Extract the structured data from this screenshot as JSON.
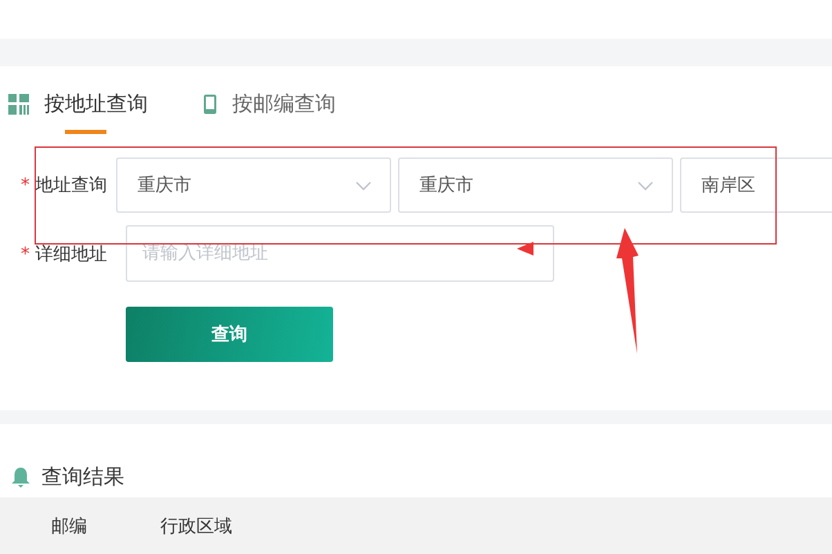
{
  "tabs": [
    {
      "label": "按地址查询",
      "selected": true
    },
    {
      "label": "按邮编查询",
      "selected": false
    }
  ],
  "form": {
    "address_label": "地址查询",
    "required_mark": "*",
    "selects": [
      {
        "value": "重庆市",
        "cut": false
      },
      {
        "value": "重庆市",
        "cut": false
      },
      {
        "value": "南岸区",
        "cut": true
      }
    ],
    "detail_label": "详细地址",
    "detail_placeholder": "请输入详细地址",
    "submit": "查询"
  },
  "results": {
    "title": "查询结果",
    "columns": [
      "邮编",
      "行政区域"
    ]
  }
}
